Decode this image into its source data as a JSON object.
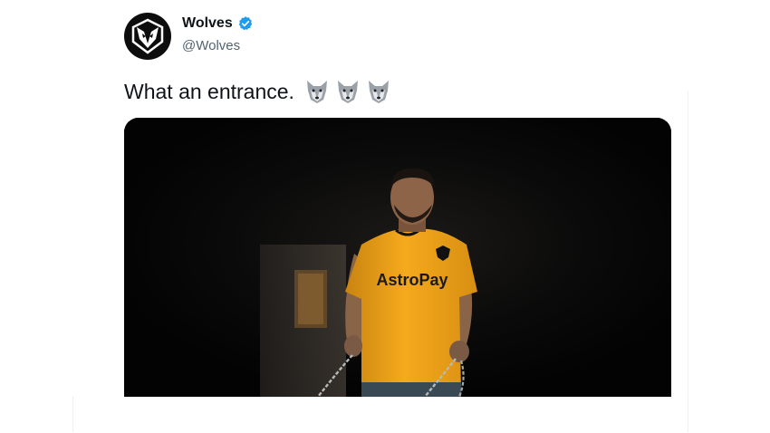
{
  "account": {
    "display_name": "Wolves",
    "handle": "@Wolves",
    "verified": true,
    "avatar_icon": "wolf-head-logo",
    "verified_icon": "verified-badge-icon"
  },
  "tweet": {
    "text": "What an entrance.",
    "emojis": [
      "wolf-emoji",
      "wolf-emoji",
      "wolf-emoji"
    ]
  },
  "media": {
    "type": "photo",
    "shirt_sponsor": "AstroPay",
    "colors": {
      "shirt": "#f2a31b",
      "background": "#050505"
    }
  },
  "colors": {
    "verified_blue": "#1d9bf0",
    "text_primary": "#0f1419",
    "text_secondary": "#536471"
  }
}
